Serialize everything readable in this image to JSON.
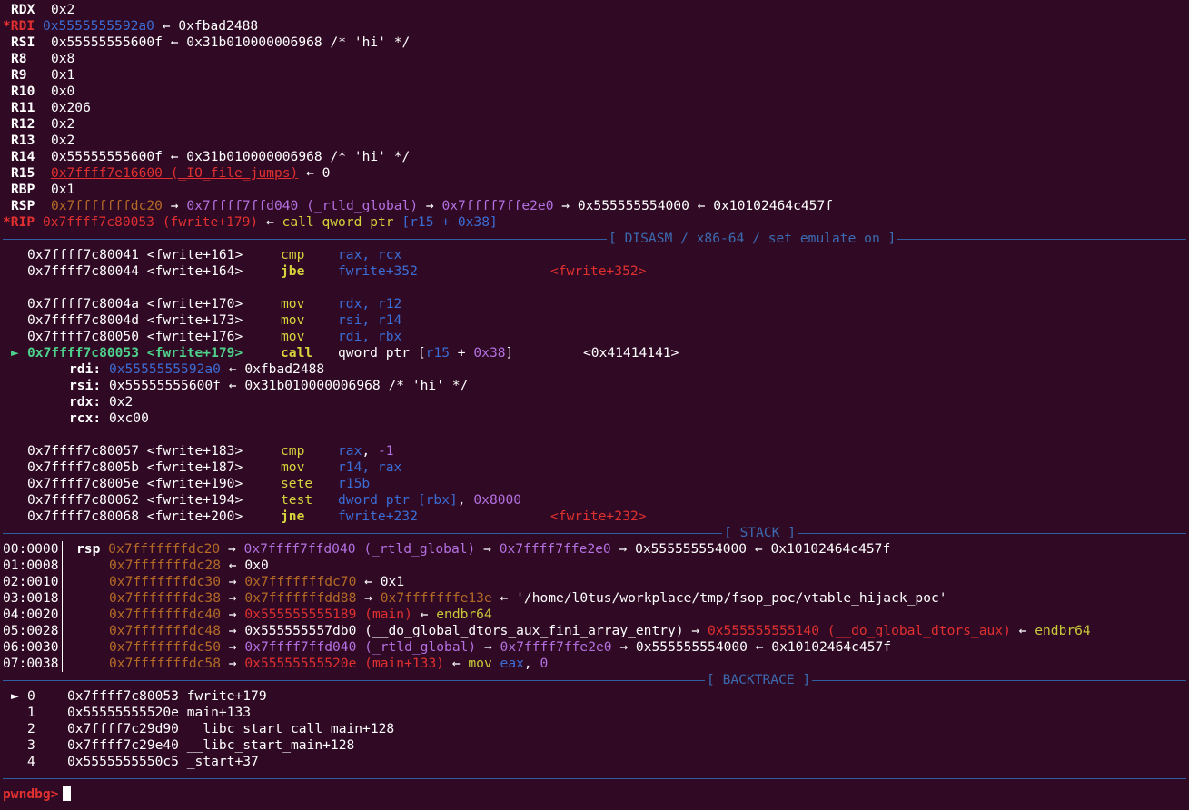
{
  "registers": [
    {
      "name": "RDX",
      "val": "0x2"
    },
    {
      "name": "*RDI",
      "val": "0x5555555592a0",
      "tail": " ← 0xfbad2488"
    },
    {
      "name": "RSI",
      "val": "0x55555555600f",
      "tail": " ← 0x31b010000006968 /* 'hi' */"
    },
    {
      "name": "R8",
      "val": "0x8"
    },
    {
      "name": "R9",
      "val": "0x1"
    },
    {
      "name": "R10",
      "val": "0x0"
    },
    {
      "name": "R11",
      "val": "0x206"
    },
    {
      "name": "R12",
      "val": "0x2"
    },
    {
      "name": "R13",
      "val": "0x2"
    },
    {
      "name": "R14",
      "val": "0x55555555600f",
      "tail": " ← 0x31b010000006968 /* 'hi' */"
    },
    {
      "name": "R15",
      "val": "0x7ffff7e16600 (_IO_file_jumps)",
      "tail": " ← 0"
    },
    {
      "name": "RBP",
      "val": "0x1"
    },
    {
      "name": "RSP",
      "p1": "0x7fffffffdc20",
      "a1": " → ",
      "p2": "0x7ffff7ffd040 (_rtld_global)",
      "a2": " → ",
      "p3": "0x7ffff7ffe2e0",
      "a3": " → 0x555555554000 ← 0x10102464c457f"
    },
    {
      "name": "*RIP",
      "p1": "0x7ffff7c80053 (fwrite+179)",
      "a1": " ← ",
      "p2": "call qword ptr ",
      "p3": "[r15 + 0x38]"
    }
  ],
  "sections": {
    "disasm": "[ DISASM / x86-64 / set emulate on ]",
    "stack": "[ STACK ]",
    "backtrace": "[ BACKTRACE ]"
  },
  "disasm": [
    {
      "addr": "0x7ffff7c80041 <fwrite+161>",
      "op": "cmp",
      "args": "rax, rcx"
    },
    {
      "addr": "0x7ffff7c80044 <fwrite+164>",
      "op": "jbe",
      "args": "fwrite+352",
      "target": "<fwrite+352>"
    },
    {
      "addr": "0x7ffff7c8004a <fwrite+170>",
      "op": "mov",
      "args": "rdx, r12"
    },
    {
      "addr": "0x7ffff7c8004d <fwrite+173>",
      "op": "mov",
      "args": "rsi, r14"
    },
    {
      "addr": "0x7ffff7c80050 <fwrite+176>",
      "op": "mov",
      "args": "rdi, rbx"
    },
    {
      "marker": "►",
      "addr": "0x7ffff7c80053 <fwrite+179>",
      "op": "call",
      "args": "qword ptr [r15 + 0x38]",
      "target": "<0x41414141>"
    },
    {
      "addr": "0x7ffff7c80057 <fwrite+183>",
      "op": "cmp",
      "args": "rax, -1"
    },
    {
      "addr": "0x7ffff7c8005b <fwrite+187>",
      "op": "mov",
      "args": "r14, rax"
    },
    {
      "addr": "0x7ffff7c8005e <fwrite+190>",
      "op": "sete",
      "args": "r15b"
    },
    {
      "addr": "0x7ffff7c80062 <fwrite+194>",
      "op": "test",
      "args": "dword ptr [rbx], 0x8000"
    },
    {
      "addr": "0x7ffff7c80068 <fwrite+200>",
      "op": "jne",
      "args": "fwrite+232",
      "target": "<fwrite+232>"
    }
  ],
  "call_args": [
    {
      "name": "rdi:",
      "val": "0x5555555592a0",
      "tail": " ← 0xfbad2488"
    },
    {
      "name": "rsi:",
      "val": "0x55555555600f",
      "tail": " ← 0x31b010000006968 /* 'hi' */"
    },
    {
      "name": "rdx:",
      "val": "0x2"
    },
    {
      "name": "rcx:",
      "val": "0xc00"
    }
  ],
  "stack": [
    {
      "idx": "00:0000",
      "reg": "rsp",
      "addr": "0x7fffffffdc20",
      "t1": " → ",
      "v1": "0x7ffff7ffd040 (_rtld_global)",
      "t2": " → ",
      "v2": "0x7ffff7ffe2e0",
      "t3": " → 0x555555554000 ← 0x10102464c457f"
    },
    {
      "idx": "01:0008",
      "reg": "",
      "addr": "0x7fffffffdc28",
      "t1": " ← 0x0"
    },
    {
      "idx": "02:0010",
      "reg": "",
      "addr": "0x7fffffffdc30",
      "t1": " → ",
      "v1": "0x7fffffffdc70",
      "t2": " ← 0x1"
    },
    {
      "idx": "03:0018",
      "reg": "",
      "addr": "0x7fffffffdc38",
      "t1": " → ",
      "v1": "0x7fffffffdd88",
      "t2": " → ",
      "v2o": "0x7fffffffe13e",
      "t3": " ← '/home/l0tus/workplace/tmp/fsop_poc/vtable_hijack_poc'"
    },
    {
      "idx": "04:0020",
      "reg": "",
      "addr": "0x7fffffffdc40",
      "t1": " → ",
      "r1": "0x555555555189 (main)",
      "t2": " ← ",
      "y1": "endbr64"
    },
    {
      "idx": "05:0028",
      "reg": "",
      "addr": "0x7fffffffdc48",
      "t1": " → 0x555555557db0 (__do_global_dtors_aux_fini_array_entry) → ",
      "r1": "0x555555555140 (__do_global_dtors_aux)",
      "t2": " ← ",
      "y1": "endbr64"
    },
    {
      "idx": "06:0030",
      "reg": "",
      "addr": "0x7fffffffdc50",
      "t1": " → ",
      "v1": "0x7ffff7ffd040 (_rtld_global)",
      "t2": " → ",
      "v2": "0x7ffff7ffe2e0",
      "t3": " → 0x555555554000 ← 0x10102464c457f"
    },
    {
      "idx": "07:0038",
      "reg": "",
      "addr": "0x7fffffffdc58",
      "t1": " → ",
      "r1": "0x55555555520e (main+133)",
      "t2": " ← ",
      "y1": "mov ",
      "bl": "eax",
      "t4": ", ",
      "m4": "0"
    }
  ],
  "backtrace": [
    {
      "marker": "►",
      "n": "0",
      "addr": "0x7ffff7c80053",
      "sym": "fwrite+179"
    },
    {
      "n": "1",
      "addr": "0x55555555520e",
      "sym": "main+133"
    },
    {
      "n": "2",
      "addr": "0x7ffff7c29d90",
      "sym": "__libc_start_call_main+128"
    },
    {
      "n": "3",
      "addr": "0x7ffff7c29e40",
      "sym": "__libc_start_main+128"
    },
    {
      "n": "4",
      "addr": "0x5555555550c5",
      "sym": "_start+37"
    }
  ],
  "prompt": "pwndbg>",
  "colors": {
    "background": "#300a24",
    "separator": "#2f5fa0",
    "modified": "#e03030",
    "heap": "#3b6cd4",
    "code": "#e03030",
    "data": "#b370e0",
    "stack": "#b46a26"
  }
}
